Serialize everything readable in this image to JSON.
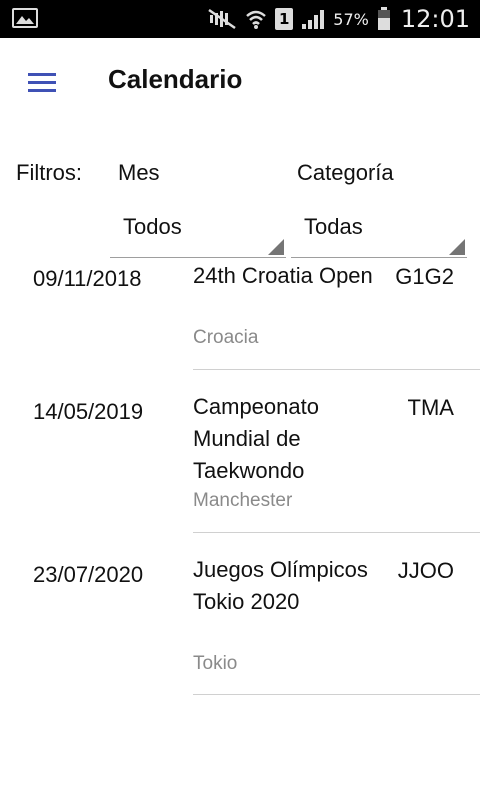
{
  "status_bar": {
    "battery_percent": "57%",
    "time": "12:01",
    "sim_slot": "1",
    "icons": [
      "image-icon",
      "mute-icon",
      "wifi-icon",
      "sim-icon",
      "signal-icon",
      "battery-icon"
    ]
  },
  "app_bar": {
    "title": "Calendario",
    "menu_icon": "hamburger-menu-icon",
    "accent_color": "#3f51b5"
  },
  "filters": {
    "label": "Filtros:",
    "month": {
      "label": "Mes",
      "selected": "Todos"
    },
    "category": {
      "label": "Categoría",
      "selected": "Todas"
    }
  },
  "events": [
    {
      "date": "09/11/2018",
      "name": "24th Croatia Open",
      "place": "Croacia",
      "category": "G1G2"
    },
    {
      "date": "14/05/2019",
      "name": "Campeonato Mundial de Taekwondo",
      "place": "Manchester",
      "category": "TMA"
    },
    {
      "date": "23/07/2020",
      "name": "Juegos Olímpicos Tokio 2020",
      "place": "Tokio",
      "category": "JJOO"
    }
  ]
}
